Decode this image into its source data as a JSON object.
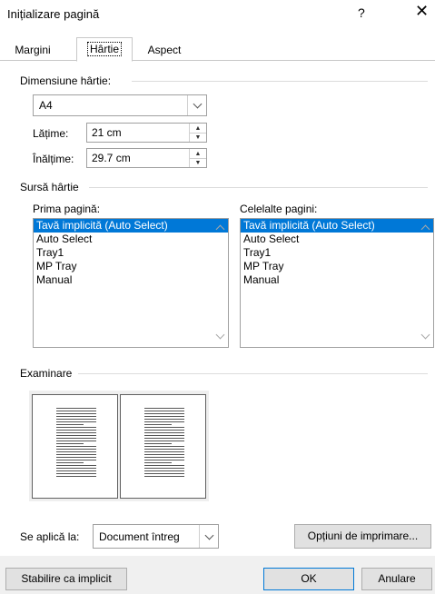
{
  "window": {
    "title": "Inițializare pagină",
    "help": "?",
    "close": "✕"
  },
  "tabs": [
    {
      "label": "Margini"
    },
    {
      "label": "Hârtie"
    },
    {
      "label": "Aspect"
    }
  ],
  "paper_size": {
    "group_label": "Dimensiune hârtie:",
    "selected": "A4",
    "width_label": "Lățime:",
    "width_value": "21 cm",
    "height_label": "Înălțime:",
    "height_value": "29.7 cm"
  },
  "paper_source": {
    "group_label": "Sursă hârtie",
    "first_page_label": "Prima pagină:",
    "other_pages_label": "Celelalte pagini:",
    "first_page_items": [
      "Tavă implicită (Auto Select)",
      "Auto Select",
      "Tray1",
      "MP Tray",
      "Manual"
    ],
    "other_pages_items": [
      "Tavă implicită (Auto Select)",
      "Auto Select",
      "Tray1",
      "MP Tray",
      "Manual"
    ]
  },
  "preview": {
    "group_label": "Examinare"
  },
  "apply_to": {
    "label": "Se aplică la:",
    "value": "Document întreg"
  },
  "buttons": {
    "print_options": "Opțiuni de imprimare...",
    "set_default": "Stabilire ca implicit",
    "ok": "OK",
    "cancel": "Anulare"
  },
  "colors": {
    "selection": "#0078d7"
  }
}
